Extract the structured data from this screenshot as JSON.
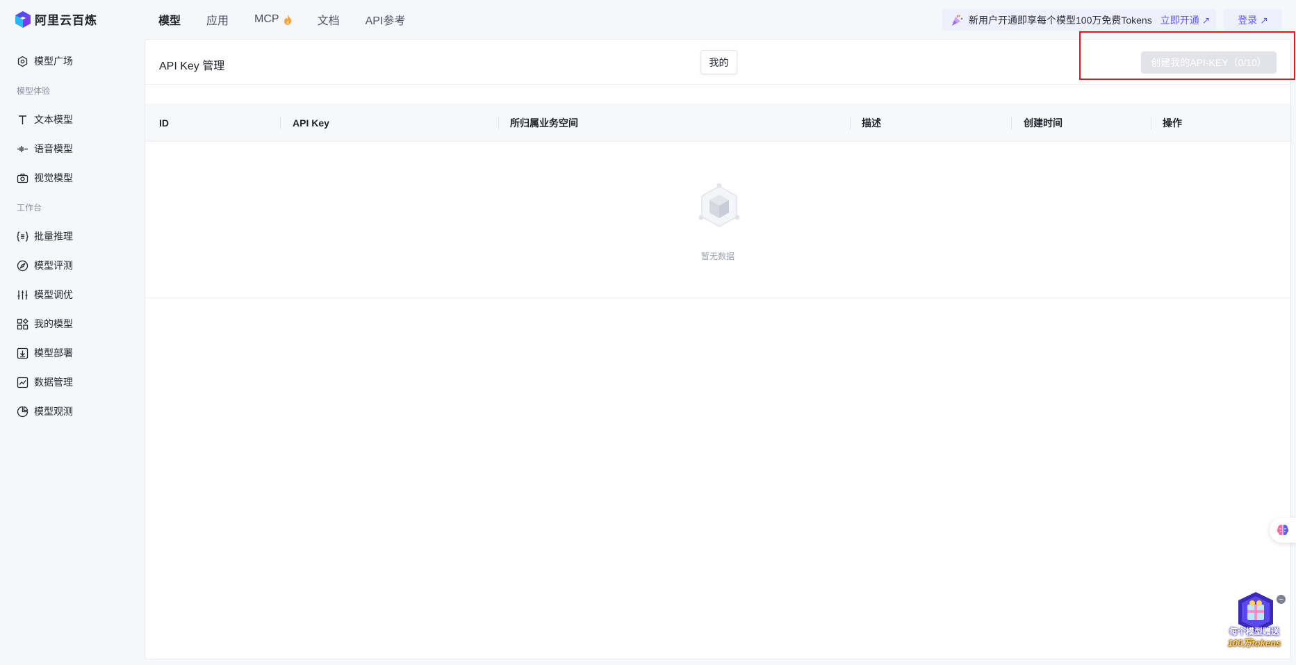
{
  "brand": {
    "name": "阿里云百炼"
  },
  "nav": {
    "items": [
      {
        "label": "模型",
        "active": true
      },
      {
        "label": "应用"
      },
      {
        "label": "MCP",
        "icon": "flame-icon"
      },
      {
        "label": "文档"
      },
      {
        "label": "API参考"
      }
    ]
  },
  "promo": {
    "text": "新用户开通即享每个模型100万免费Tokens",
    "link": "立即开通 ↗"
  },
  "login": {
    "label": "登录 ↗"
  },
  "sidebar": {
    "top_item": {
      "label": "模型广场",
      "icon": "model-square-icon"
    },
    "groups": [
      {
        "title": "模型体验",
        "items": [
          {
            "label": "文本模型",
            "icon": "text-icon"
          },
          {
            "label": "语音模型",
            "icon": "waveform-icon"
          },
          {
            "label": "视觉模型",
            "icon": "camera-icon"
          }
        ]
      },
      {
        "title": "工作台",
        "items": [
          {
            "label": "批量推理",
            "icon": "batch-icon"
          },
          {
            "label": "模型评测",
            "icon": "compass-icon"
          },
          {
            "label": "模型调优",
            "icon": "sliders-icon"
          },
          {
            "label": "我的模型",
            "icon": "grid-icon"
          },
          {
            "label": "模型部署",
            "icon": "deploy-icon"
          },
          {
            "label": "数据管理",
            "icon": "chart-icon"
          },
          {
            "label": "模型观测",
            "icon": "pie-icon"
          }
        ]
      }
    ]
  },
  "main": {
    "title": "API Key 管理",
    "tab": "我的",
    "create_button": "创建我的API-KEY（0/10）",
    "table": {
      "columns": [
        "ID",
        "API Key",
        "所归属业务空间",
        "描述",
        "创建时间",
        "操作"
      ]
    },
    "empty_text": "暂无数据"
  },
  "gift": {
    "caption": "每个模型赠送",
    "tokens": "100万tokens"
  },
  "colors": {
    "accent": "#615ced",
    "highlight": "#e8171c",
    "disabled_button": "#e2e3e8"
  }
}
